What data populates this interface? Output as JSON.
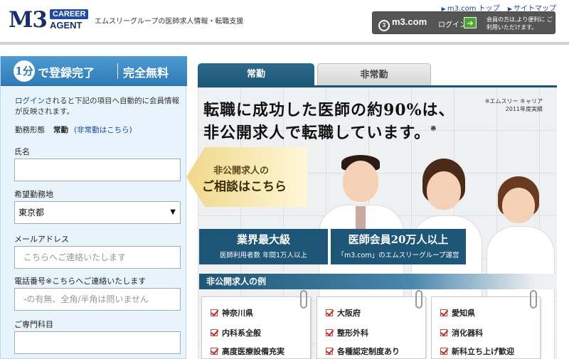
{
  "header": {
    "logo": {
      "m3": "M3",
      "career": "CAREER",
      "agent": "AGENT"
    },
    "tagline": "エムスリーグループの医師求人情報・転職支援",
    "toplinks": [
      "m3.com トップ",
      "サイトマップ"
    ],
    "m3login": {
      "brand": "m3.com",
      "login_label": "ログイン",
      "note": "会員の方は,より便利に ご利用いただけます。"
    }
  },
  "form": {
    "banner": {
      "badge": "1分",
      "main": "で登録完了",
      "free": "完全無料"
    },
    "note_link": "ログイン",
    "note_text": "されると下記の項目へ自動的に会員情報が反映されます。",
    "worktype_label": "勤務形態",
    "worktype_value": "常勤",
    "worktype_link": "(非常勤はこちら)",
    "fields": {
      "name_label": "氏名",
      "area_label": "希望勤務地",
      "area_value": "東京都",
      "email_label": "メールアドレス",
      "email_placeholder": "こちらへご連絡いたします",
      "phone_label": "電話番号※こちらへご連絡いたします",
      "phone_placeholder": "-の有無、全角/半角は問いません",
      "specialty_label": "ご専門科目"
    }
  },
  "tabs": {
    "full_time": "常勤",
    "part_time": "非常勤"
  },
  "hero": {
    "headline1": "転職に成功した医師の約90%は、",
    "headline2": "非公開求人で転職しています。",
    "headline_mark": "※",
    "footnote1": "※エムスリー キャリア",
    "footnote2": "2011年度実績",
    "consult1": "非公開求人の",
    "consult2": "ご相談はこちら",
    "stat1_big": "業界最大級",
    "stat1_small": "医師利用者数 年間1万人以上",
    "stat2_big": "医師会員20万人以上",
    "stat2_small": "「m3.com」のエムスリーグループ運営"
  },
  "examples": {
    "heading": "非公開求人の例",
    "col1": [
      "神奈川県",
      "内科系全般",
      "高度医療設備充実"
    ],
    "col2": [
      "大阪府",
      "整形外科",
      "各種認定制度あり"
    ],
    "col3": [
      "愛知県",
      "消化器科",
      "新科立ち上げ歓迎"
    ]
  }
}
